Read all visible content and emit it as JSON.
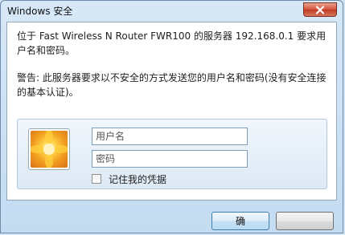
{
  "window": {
    "title": "Windows 安全"
  },
  "message": {
    "line1": "位于 Fast Wireless N Router FWR100 的服务器 192.168.0.1 要求用户名和密码。",
    "line2": "警告: 此服务器要求以不安全的方式发送您的用户名和密码(没有安全连接的基本认证)。"
  },
  "credentials": {
    "username_placeholder": "用户名",
    "username_value": "",
    "password_placeholder": "密码",
    "password_value": "",
    "remember_label": "记住我的凭据",
    "remember_checked": false
  },
  "buttons": {
    "ok_label": "确",
    "cancel_label": ""
  },
  "colors": {
    "accent": "#3c7fb1",
    "close_button": "#c23a22",
    "frame": "#c4dbf1"
  }
}
